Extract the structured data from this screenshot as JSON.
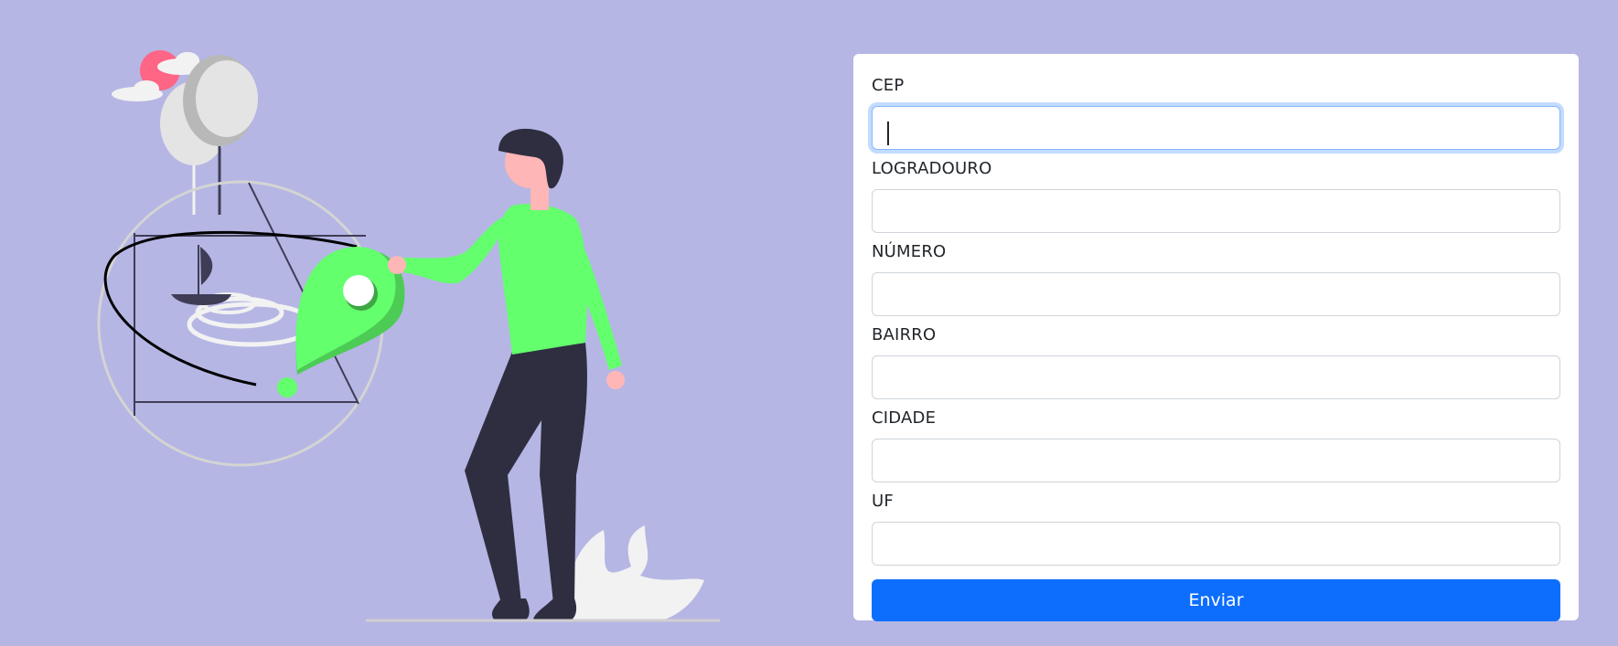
{
  "form": {
    "fields": [
      {
        "label": "CEP",
        "value": ""
      },
      {
        "label": "LOGRADOURO",
        "value": ""
      },
      {
        "label": "NÚMERO",
        "value": ""
      },
      {
        "label": "BAIRRO",
        "value": ""
      },
      {
        "label": "CIDADE",
        "value": ""
      },
      {
        "label": "UF",
        "value": ""
      }
    ],
    "submit_label": "Enviar"
  },
  "colors": {
    "background": "#b5b6e4",
    "accent_green": "#63ff6d",
    "button_blue": "#0d6efd",
    "sun": "#ff6584",
    "dark": "#2f2e41"
  }
}
